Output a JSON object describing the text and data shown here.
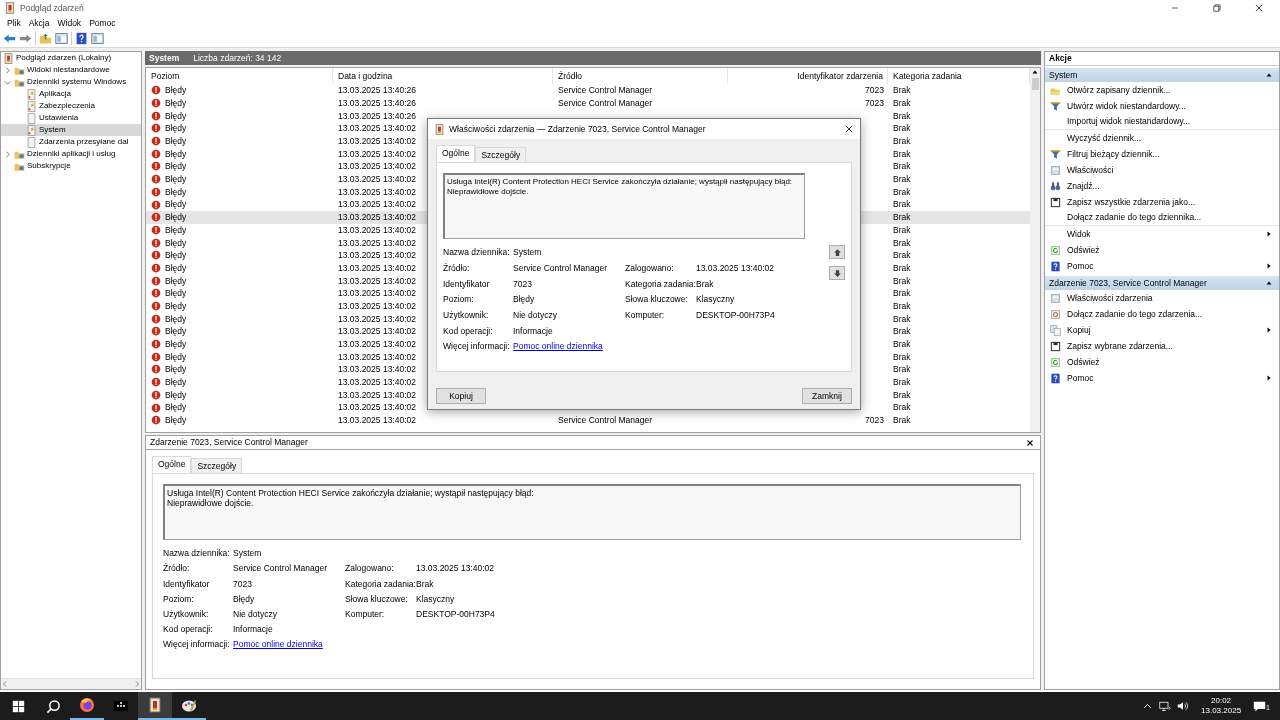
{
  "window": {
    "title": "Podgląd zdarzeń"
  },
  "menu": [
    "Plik",
    "Akcja",
    "Widok",
    "Pomoc"
  ],
  "tree": [
    {
      "label": "Podgląd zdarzeń (Lokalny)",
      "kind": "root",
      "selected": false,
      "children": [
        {
          "label": "Widoki niestandardowe",
          "kind": "folder",
          "expanded": false,
          "selected": false
        },
        {
          "label": "Dzienniki systemu Windows",
          "kind": "folder",
          "expanded": true,
          "selected": false,
          "children": [
            {
              "label": "Aplikacja",
              "kind": "log",
              "selected": false
            },
            {
              "label": "Zabezpieczenia",
              "kind": "log",
              "selected": false
            },
            {
              "label": "Ustawienia",
              "kind": "log_empty",
              "selected": false
            },
            {
              "label": "System",
              "kind": "log",
              "selected": true
            },
            {
              "label": "Zdarzenia przesyłane dal",
              "kind": "log_empty",
              "selected": false
            }
          ]
        },
        {
          "label": "Dzienniki aplikacji i usług",
          "kind": "folder",
          "expanded": false,
          "selected": false
        },
        {
          "label": "Subskrypcje",
          "kind": "folder",
          "selected": false
        }
      ]
    }
  ],
  "log_header": {
    "name": "System",
    "count": "Liczba zdarzeń: 34 142"
  },
  "table": {
    "columns": [
      "Poziom",
      "Data i godzina",
      "Źródło",
      "Identyfikator zdarzenia",
      "Kategoria zadania"
    ],
    "rows": [
      {
        "severity": "Błędy",
        "date": "13.03.2025 13:40:26",
        "source": "Service Control Manager",
        "event_id": "7023",
        "category": "Brak",
        "selected": false
      },
      {
        "severity": "Błędy",
        "date": "13.03.2025 13:40:26",
        "source": "Service Control Manager",
        "event_id": "7023",
        "category": "Brak",
        "selected": false
      },
      {
        "severity": "Błędy",
        "date": "13.03.2025 13:40:26",
        "category": "Brak",
        "selected": false
      },
      {
        "severity": "Błędy",
        "date": "13.03.2025 13:40:02",
        "category": "Brak",
        "selected": false
      },
      {
        "severity": "Błędy",
        "date": "13.03.2025 13:40:02",
        "category": "Brak",
        "selected": false
      },
      {
        "severity": "Błędy",
        "date": "13.03.2025 13:40:02",
        "category": "Brak",
        "selected": false
      },
      {
        "severity": "Błędy",
        "date": "13.03.2025 13:40:02",
        "category": "Brak",
        "selected": false
      },
      {
        "severity": "Błędy",
        "date": "13.03.2025 13:40:02",
        "category": "Brak",
        "selected": false
      },
      {
        "severity": "Błędy",
        "date": "13.03.2025 13:40:02",
        "category": "Brak",
        "selected": false
      },
      {
        "severity": "Błędy",
        "date": "13.03.2025 13:40:02",
        "category": "Brak",
        "selected": false
      },
      {
        "severity": "Błędy",
        "date": "13.03.2025 13:40:02",
        "category": "Brak",
        "selected": true
      },
      {
        "severity": "Błędy",
        "date": "13.03.2025 13:40:02",
        "category": "Brak",
        "selected": false
      },
      {
        "severity": "Błędy",
        "date": "13.03.2025 13:40:02",
        "category": "Brak",
        "selected": false
      },
      {
        "severity": "Błędy",
        "date": "13.03.2025 13:40:02",
        "category": "Brak",
        "selected": false
      },
      {
        "severity": "Błędy",
        "date": "13.03.2025 13:40:02",
        "category": "Brak",
        "selected": false
      },
      {
        "severity": "Błędy",
        "date": "13.03.2025 13:40:02",
        "category": "Brak",
        "selected": false
      },
      {
        "severity": "Błędy",
        "date": "13.03.2025 13:40:02",
        "category": "Brak",
        "selected": false
      },
      {
        "severity": "Błędy",
        "date": "13.03.2025 13:40:02",
        "category": "Brak",
        "selected": false
      },
      {
        "severity": "Błędy",
        "date": "13.03.2025 13:40:02",
        "category": "Brak",
        "selected": false
      },
      {
        "severity": "Błędy",
        "date": "13.03.2025 13:40:02",
        "category": "Brak",
        "selected": false
      },
      {
        "severity": "Błędy",
        "date": "13.03.2025 13:40:02",
        "category": "Brak",
        "selected": false
      },
      {
        "severity": "Błędy",
        "date": "13.03.2025 13:40:02",
        "category": "Brak",
        "selected": false
      },
      {
        "severity": "Błędy",
        "date": "13.03.2025 13:40:02",
        "category": "Brak",
        "selected": false
      },
      {
        "severity": "Błędy",
        "date": "13.03.2025 13:40:02",
        "category": "Brak",
        "selected": false
      },
      {
        "severity": "Błędy",
        "date": "13.03.2025 13:40:02",
        "category": "Brak",
        "selected": false
      },
      {
        "severity": "Błędy",
        "date": "13.03.2025 13:40:02",
        "category": "Brak",
        "selected": false
      },
      {
        "severity": "Błędy",
        "date": "13.03.2025 13:40:02",
        "source": "Service Control Manager",
        "event_id": "7023",
        "category": "Brak",
        "selected": false
      }
    ]
  },
  "preview": {
    "title": "Zdarzenie 7023, Service Control Manager",
    "tabs": [
      {
        "label": "Ogólne",
        "selected": true
      },
      {
        "label": "Szczegóły",
        "selected": false
      }
    ],
    "description": "Usługa Intel(R) Content Protection HECI Service zakończyła działanie; wystąpił następujący błąd: \nNieprawidłowe dojście.",
    "details": [
      {
        "label": "Nazwa dziennika:",
        "value": "System"
      },
      {
        "label": "Źródło:",
        "value": "Service Control Manager",
        "label_2": "Zalogowano:",
        "value_2": "13.03.2025 13:40:02"
      },
      {
        "label": "Identyfikator",
        "value": "7023",
        "label_2": "Kategoria zadania:",
        "value_2": "Brak"
      },
      {
        "label": "Poziom:",
        "value": "Błędy",
        "label_2": "Słowa kluczowe:",
        "value_2": "Klasyczny"
      },
      {
        "label": "Użytkownik:",
        "value": "Nie dotyczy",
        "label_2": "Komputer:",
        "value_2": "DESKTOP-00H73P4"
      },
      {
        "label": "Kod operacji:",
        "value": "Informacje"
      },
      {
        "label": "Więcej informacji:",
        "link": "Pomoc online dziennika"
      }
    ]
  },
  "dialog": {
    "title": "Właściwości zdarzenia — Zdarzenie 7023, Service Control Manager",
    "tabs": [
      {
        "label": "Ogólne",
        "selected": true
      },
      {
        "label": "Szczegóły",
        "selected": false
      }
    ],
    "description": "Usługa Intel(R) Content Protection HECI Service zakończyła działanie; wystąpił następujący błąd: \nNieprawidłowe dojście.",
    "details": [
      {
        "label": "Nazwa dziennika:",
        "value": "System"
      },
      {
        "label": "Źródło:",
        "value": "Service Control Manager",
        "label_2": "Zalogowano:",
        "value_2": "13.03.2025 13:40:02"
      },
      {
        "label": "Identyfikator",
        "value": "7023",
        "label_2": "Kategoria zadania:",
        "value_2": "Brak"
      },
      {
        "label": "Poziom:",
        "value": "Błędy",
        "label_2": "Słowa kluczowe:",
        "value_2": "Klasyczny"
      },
      {
        "label": "Użytkownik:",
        "value": "Nie dotyczy",
        "label_2": "Komputer:",
        "value_2": "DESKTOP-00H73P4"
      },
      {
        "label": "Kod operacji:",
        "value": "Informacje"
      },
      {
        "label": "Więcej informacji:",
        "link": "Pomoc online dziennika"
      }
    ],
    "buttons": [
      "Kopiuj",
      "Zamknij"
    ]
  },
  "actions": {
    "title": "Akcje",
    "sections": [
      {
        "title": "System",
        "expanded": true,
        "items": [
          {
            "label": "Otwórz zapisany dziennik...",
            "kind": "open"
          },
          {
            "label": "Utwórz widok niestandardowy...",
            "kind": "filter"
          },
          {
            "label": "Importuj widok niestandardowy...",
            "kind": "none",
            "separator_after": true
          },
          {
            "label": "Wyczyść dziennik...",
            "kind": "none"
          },
          {
            "label": "Filtruj bieżący dziennik...",
            "kind": "filter"
          },
          {
            "label": "Właściwości",
            "kind": "sheet"
          },
          {
            "label": "Znajdź...",
            "kind": "find"
          },
          {
            "label": "Zapisz wszystkie zdarzenia jako...",
            "kind": "save"
          },
          {
            "label": "Dołącz zadanie do tego dziennika...",
            "kind": "none",
            "separator_after": true
          },
          {
            "label": "Widok",
            "kind": "none",
            "submenu": true
          },
          {
            "label": "Odśwież",
            "kind": "refresh"
          },
          {
            "label": "Pomoc",
            "kind": "help",
            "submenu": true
          }
        ]
      },
      {
        "title": "Zdarzenie 7023, Service Control Manager",
        "expanded": true,
        "items": [
          {
            "label": "Właściwości zdarzenia",
            "kind": "sheet"
          },
          {
            "label": "Dołącz zadanie do tego zdarzenia...",
            "kind": "task"
          },
          {
            "label": "Kopiuj",
            "kind": "copy",
            "submenu": true
          },
          {
            "label": "Zapisz wybrane zdarzenia...",
            "kind": "save"
          },
          {
            "label": "Odśwież",
            "kind": "refresh"
          },
          {
            "label": "Pomoc",
            "kind": "help",
            "submenu": true
          }
        ]
      }
    ]
  },
  "taskbar": {
    "apps": [
      {
        "kind": "browser",
        "running": true,
        "selected": false
      },
      {
        "kind": "terminal",
        "running": false,
        "selected": false
      },
      {
        "kind": "viewer",
        "running": true,
        "selected": true
      },
      {
        "kind": "paint",
        "running": true,
        "selected": false
      }
    ],
    "time": "20:02",
    "date": "13.03.2025",
    "notification_count": "1"
  }
}
